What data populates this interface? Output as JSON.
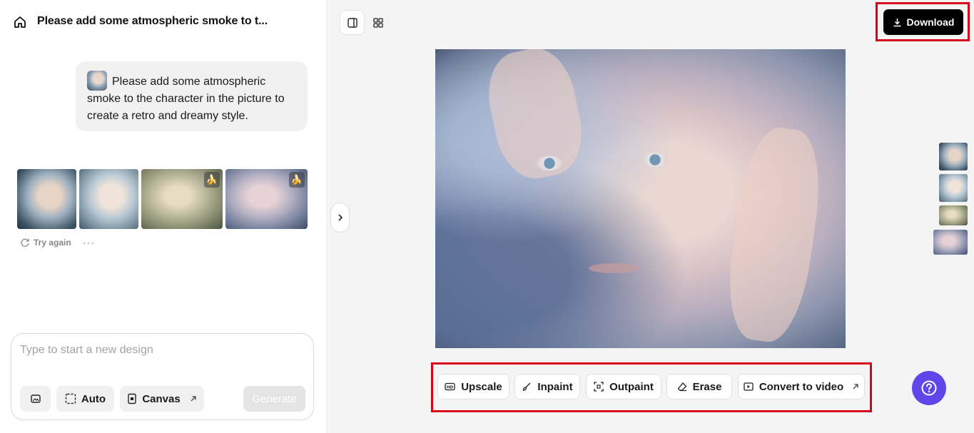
{
  "header": {
    "title": "Please add some atmospheric smoke to t..."
  },
  "chat": {
    "prompt": "Please add some atmospheric smoke to the character in the picture to create a retro and dreamy style.",
    "try_again": "Try again",
    "more": "···"
  },
  "composer": {
    "placeholder": "Type to start a new design",
    "auto_label": "Auto",
    "canvas_label": "Canvas",
    "generate_label": "Generate"
  },
  "toolbar": {
    "download_label": "Download"
  },
  "tools": {
    "upscale": "Upscale",
    "inpaint": "Inpaint",
    "outpaint": "Outpaint",
    "erase": "Erase",
    "convert": "Convert to video"
  },
  "colors": {
    "accent": "#6046e8",
    "highlight": "#d8001a",
    "download_bg": "#000000",
    "badge": "#f3c21b"
  },
  "icons": [
    "home-icon",
    "refresh-icon",
    "more-icon",
    "image-icon",
    "auto-icon",
    "canvas-icon",
    "external-link-icon",
    "split-view-icon",
    "grid-view-icon",
    "download-icon",
    "chevron-right-icon",
    "hd-icon",
    "brush-icon",
    "outpaint-icon",
    "eraser-icon",
    "video-icon",
    "help-icon",
    "banana-icon"
  ]
}
